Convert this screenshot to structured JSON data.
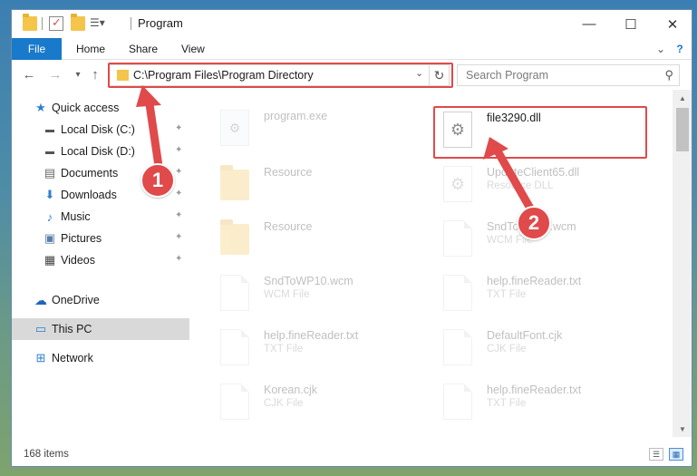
{
  "window": {
    "title": "Program",
    "controls": {
      "minimize": "—",
      "maximize": "☐",
      "close": "✕"
    }
  },
  "ribbon": {
    "tabs": [
      "File",
      "Home",
      "Share",
      "View"
    ],
    "help_icon": "?"
  },
  "navigation": {
    "back_icon": "←",
    "forward_icon": "→",
    "recent_icon": "▾",
    "up_icon": "↑",
    "address_path": "C:\\Program Files\\Program Directory",
    "address_dropdown_icon": "⌄",
    "refresh_icon": "↻",
    "search_placeholder": "Search Program",
    "search_icon": "⚲"
  },
  "sidebar": {
    "items": [
      {
        "label": "Quick access",
        "icon": "star-icon",
        "glyph": "★",
        "pinned": false
      },
      {
        "label": "Local Disk (C:)",
        "icon": "drive-icon",
        "glyph": "▬",
        "pinned": true
      },
      {
        "label": "Local Disk (D:)",
        "icon": "drive-icon",
        "glyph": "▬",
        "pinned": true
      },
      {
        "label": "Documents",
        "icon": "documents-icon",
        "glyph": "▤",
        "pinned": true
      },
      {
        "label": "Downloads",
        "icon": "download-icon",
        "glyph": "⬇",
        "pinned": true
      },
      {
        "label": "Music",
        "icon": "music-icon",
        "glyph": "♪",
        "pinned": true
      },
      {
        "label": "Pictures",
        "icon": "pictures-icon",
        "glyph": "▣",
        "pinned": true
      },
      {
        "label": "Videos",
        "icon": "videos-icon",
        "glyph": "▦",
        "pinned": true
      },
      {
        "label": "OneDrive",
        "icon": "cloud-icon",
        "glyph": "☁",
        "pinned": false
      },
      {
        "label": "This PC",
        "icon": "computer-icon",
        "glyph": "▭",
        "pinned": false
      },
      {
        "label": "Network",
        "icon": "network-icon",
        "glyph": "⊞",
        "pinned": false
      }
    ],
    "pin_glyph": "📌"
  },
  "files": [
    {
      "name": "program.exe",
      "type": "",
      "kind": "exe"
    },
    {
      "name": "file3290.dll",
      "type": "",
      "kind": "dll"
    },
    {
      "name": "Resource",
      "type": "",
      "kind": "folder"
    },
    {
      "name": "UpdateClient65.dll",
      "type": "Resource DLL",
      "kind": "dll"
    },
    {
      "name": "Resource",
      "type": "",
      "kind": "folder"
    },
    {
      "name": "SndToWP10.wcm",
      "type": "WCM File",
      "kind": "doc"
    },
    {
      "name": "SndToWP10.wcm",
      "type": "WCM File",
      "kind": "doc"
    },
    {
      "name": "help.fineReader.txt",
      "type": "TXT File",
      "kind": "doc"
    },
    {
      "name": "help.fineReader.txt",
      "type": "TXT File",
      "kind": "doc"
    },
    {
      "name": "DefaultFont.cjk",
      "type": "CJK File",
      "kind": "doc"
    },
    {
      "name": "Korean.cjk",
      "type": "CJK File",
      "kind": "doc"
    },
    {
      "name": "help.fineReader.txt",
      "type": "TXT File",
      "kind": "doc"
    }
  ],
  "status": {
    "item_count": "168 items"
  },
  "annotations": {
    "callout_1": "1",
    "callout_2": "2",
    "highlight_color": "#e04a4a"
  },
  "colors": {
    "accent": "#1979ca",
    "selected": "#d9d9d9",
    "folder": "#f2c14b"
  }
}
